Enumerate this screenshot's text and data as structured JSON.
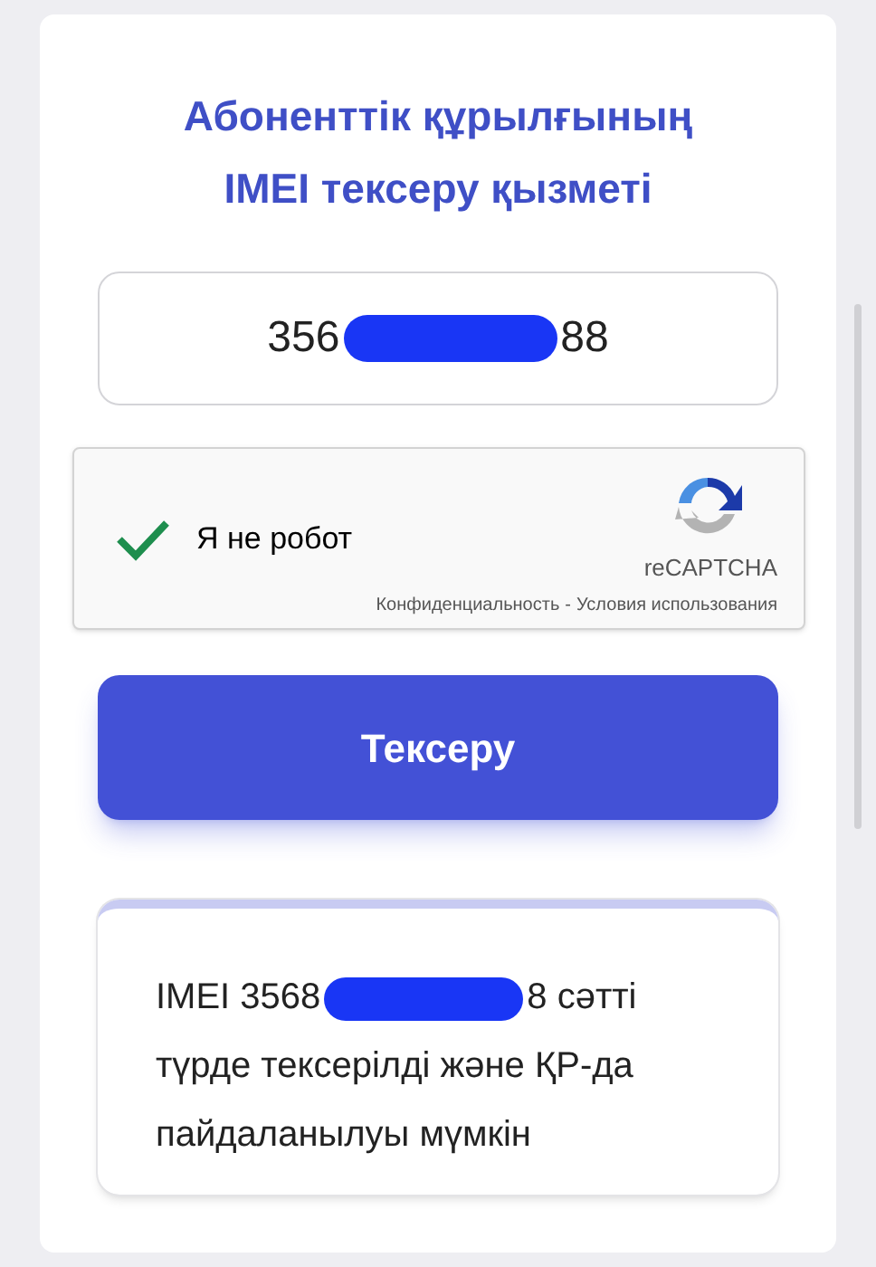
{
  "title": "Абоненттік құрылғының IMEI тексеру қызметі",
  "imei_field": {
    "value_start": "356",
    "value_end": "88"
  },
  "captcha": {
    "checked": true,
    "label": "Я не робот",
    "brand": "reCAPTCHA",
    "privacy_link": "Конфиденциальность",
    "separator": "-",
    "terms_link": "Условия использования"
  },
  "check_button": "Тексеру",
  "result": {
    "text_start": "IMEI 3568",
    "text_end": "8 сәтті түрде тексерілді және ҚР-да пайдаланылуы мүмкін"
  }
}
